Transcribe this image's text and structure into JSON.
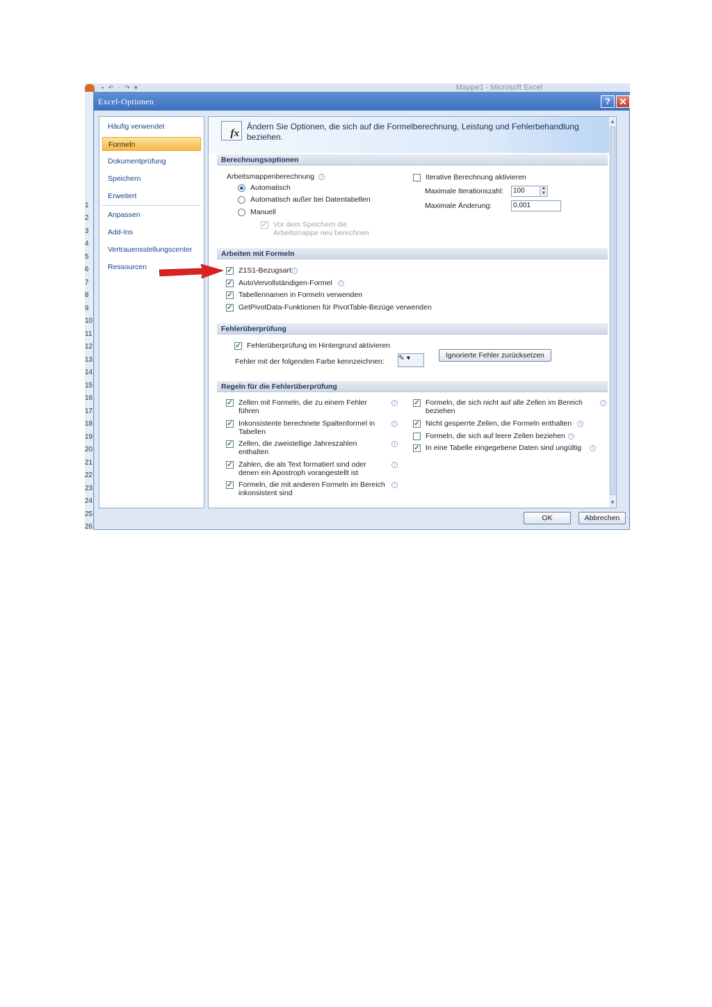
{
  "excel": {
    "window_title": "Mappe1 - Microsoft Excel",
    "qat_glyphs": "▪ ↶ · ↷ ▾",
    "row_numbers": [
      "1",
      "2",
      "3",
      "4",
      "5",
      "6",
      "7",
      "8",
      "9",
      "10",
      "11",
      "12",
      "13",
      "14",
      "15",
      "16",
      "17",
      "18",
      "19",
      "20",
      "21",
      "22",
      "23",
      "24",
      "25",
      "26"
    ]
  },
  "dialog": {
    "title": "Excel-Optionen",
    "help_glyph": "?",
    "close_glyph": "✕",
    "ok_label": "OK",
    "cancel_label": "Abbrechen"
  },
  "nav": {
    "items": [
      "Häufig verwendet",
      "Formeln",
      "Dokumentprüfung",
      "Speichern",
      "Erweitert",
      "Anpassen",
      "Add-Ins",
      "Vertrauensstellungscenter",
      "Ressourcen"
    ],
    "active": "Formeln"
  },
  "header": {
    "icon_text": "fx",
    "text": "Ändern Sie Optionen, die sich auf die Formelberechnung, Leistung  und Fehlerbehandlung beziehen."
  },
  "calc": {
    "section": "Berechnungsoptionen",
    "workbook_label": "Arbeitsmappenberechnung",
    "radio_auto": "Automatisch",
    "radio_auto_except": "Automatisch außer bei Datentabellen",
    "radio_manual": "Manuell",
    "recalc_before_save_1": "Vor dem Speichern die",
    "recalc_before_save_2": "Arbeitsmappe neu berechnen",
    "iterative_label": "Iterative Berechnung aktivieren",
    "max_iter_label": "Maximale Iterationszahl:",
    "max_iter_value": "100",
    "max_change_label": "Maximale Änderung:",
    "max_change_value": "0,001"
  },
  "formulas": {
    "section": "Arbeiten mit Formeln",
    "r1c1": "Z1S1-Bezugsart",
    "autocomplete": "AutoVervollständigen-Formel",
    "table_names": "Tabellennamen in Formeln verwenden",
    "getpivot": "GetPivotData-Funktionen für PivotTable-Bezüge verwenden"
  },
  "errcheck": {
    "section": "Fehlerüberprüfung",
    "background": "Fehlerüberprüfung im Hintergrund aktivieren",
    "color_label": "Fehler mit der folgenden Farbe kennzeichnen:",
    "color_glyph": "✎ ▾",
    "reset_button": "Ignorierte Fehler zurücksetzen"
  },
  "rules": {
    "section": "Regeln für die Fehlerüberprüfung",
    "left": [
      {
        "l1": "Zellen mit Formeln, die zu einem Fehler",
        "l2": "führen",
        "checked": true
      },
      {
        "l1": "Inkonsistente berechnete Spaltenformel in",
        "l2": "Tabellen",
        "checked": true
      },
      {
        "l1": "Zellen, die zweistellige Jahreszahlen",
        "l2": "enthalten",
        "checked": true
      },
      {
        "l1": "Zahlen, die als Text formatiert sind oder",
        "l2": "denen ein Apostroph vorangestellt ist",
        "checked": true
      },
      {
        "l1": "Formeln, die mit anderen Formeln im Bereich",
        "l2": "inkonsistent sind",
        "checked": true
      }
    ],
    "right": [
      {
        "l1": "Formeln, die sich nicht auf alle Zellen im Bereich",
        "l2": "beziehen",
        "checked": true
      },
      {
        "l1": "Nicht gesperrte Zellen, die Formeln enthalten",
        "l2": "",
        "checked": true
      },
      {
        "l1": "Formeln, die sich auf leere Zellen beziehen",
        "l2": "",
        "checked": false
      },
      {
        "l1": "In eine Tabelle eingegebene Daten sind ungültig",
        "l2": "",
        "checked": true
      }
    ]
  },
  "glyphs": {
    "check": "✓",
    "info": "i",
    "up": "▲",
    "down": "▼"
  },
  "colors": {
    "active_nav": "#f8b84a",
    "arrow": "#e02020",
    "titlebar": "#3e70c0"
  }
}
